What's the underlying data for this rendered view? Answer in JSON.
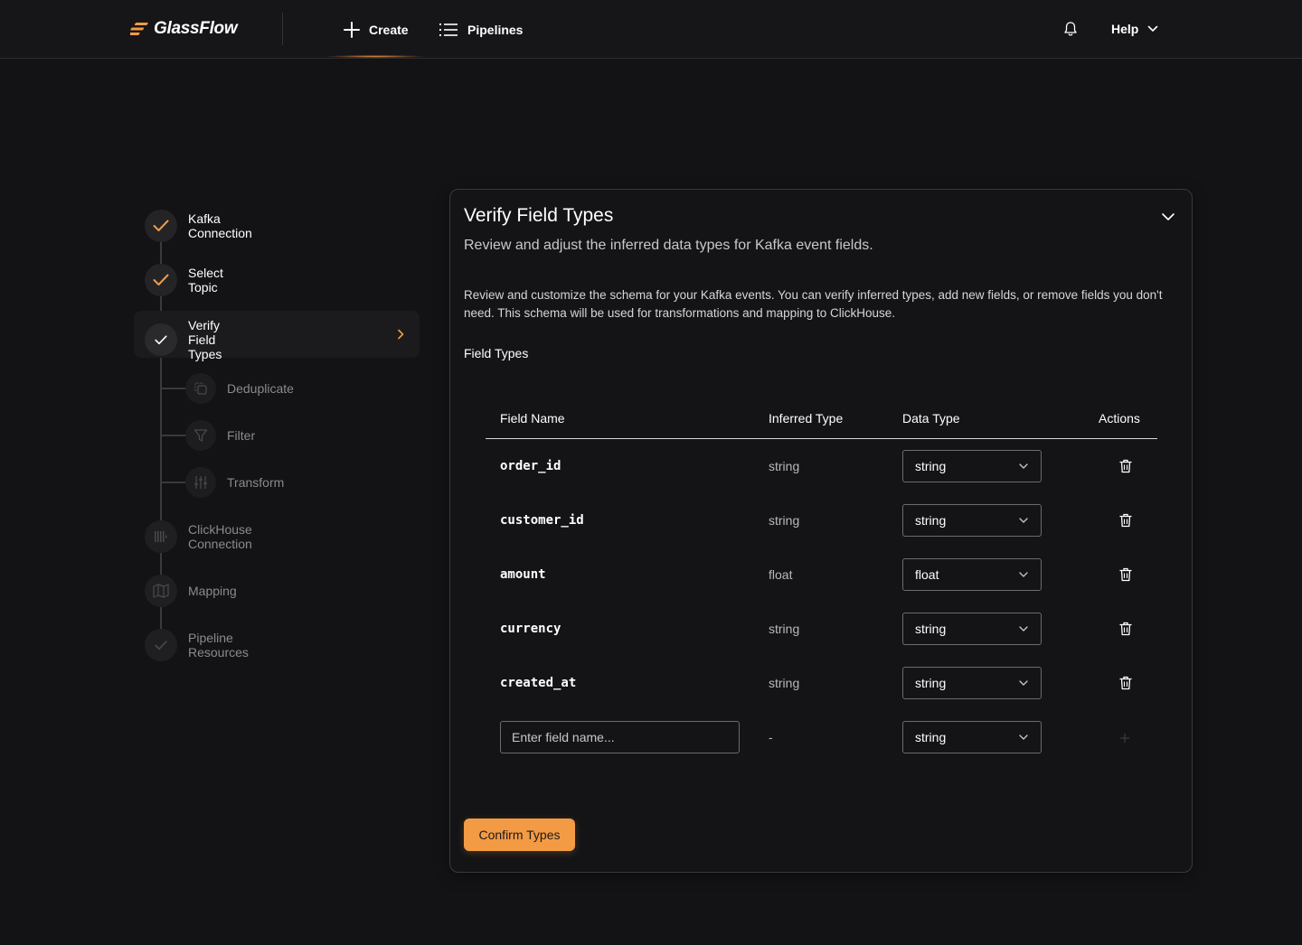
{
  "header": {
    "logo_text": "GlassFlow",
    "nav": [
      {
        "label": "Create",
        "icon": "plus-icon"
      },
      {
        "label": "Pipelines",
        "icon": "list-icon"
      }
    ],
    "help_label": "Help"
  },
  "stepper": {
    "steps": [
      {
        "label": "Kafka Connection",
        "state": "completed"
      },
      {
        "label": "Select Topic",
        "state": "completed"
      },
      {
        "label": "Verify Field Types",
        "state": "active"
      },
      {
        "label": "Deduplicate",
        "state": "pending",
        "substep": true
      },
      {
        "label": "Filter",
        "state": "pending",
        "substep": true
      },
      {
        "label": "Transform",
        "state": "pending",
        "substep": true
      },
      {
        "label": "ClickHouse Connection",
        "state": "pending"
      },
      {
        "label": "Mapping",
        "state": "pending"
      },
      {
        "label": "Pipeline Resources",
        "state": "pending"
      }
    ]
  },
  "card": {
    "title": "Verify Field Types",
    "subtitle": "Review and adjust the inferred data types for Kafka event fields.",
    "description": "Review and customize the schema for your Kafka events. You can verify inferred types, add new fields, or remove fields you don't need. This schema will be used for transformations and mapping to ClickHouse.",
    "section_label": "Field Types",
    "columns": [
      "Field Name",
      "Inferred Type",
      "Data Type",
      "Actions"
    ],
    "rows": [
      {
        "field": "order_id",
        "inferred": "string",
        "data_type": "string"
      },
      {
        "field": "customer_id",
        "inferred": "string",
        "data_type": "string"
      },
      {
        "field": "amount",
        "inferred": "float",
        "data_type": "float"
      },
      {
        "field": "currency",
        "inferred": "string",
        "data_type": "string"
      },
      {
        "field": "created_at",
        "inferred": "string",
        "data_type": "string"
      }
    ],
    "new_row": {
      "placeholder": "Enter field name...",
      "inferred": "-",
      "data_type": "string"
    },
    "confirm_label": "Confirm Types"
  },
  "colors": {
    "accent": "#f39a45",
    "background": "#131315",
    "card_border": "#39393c"
  }
}
